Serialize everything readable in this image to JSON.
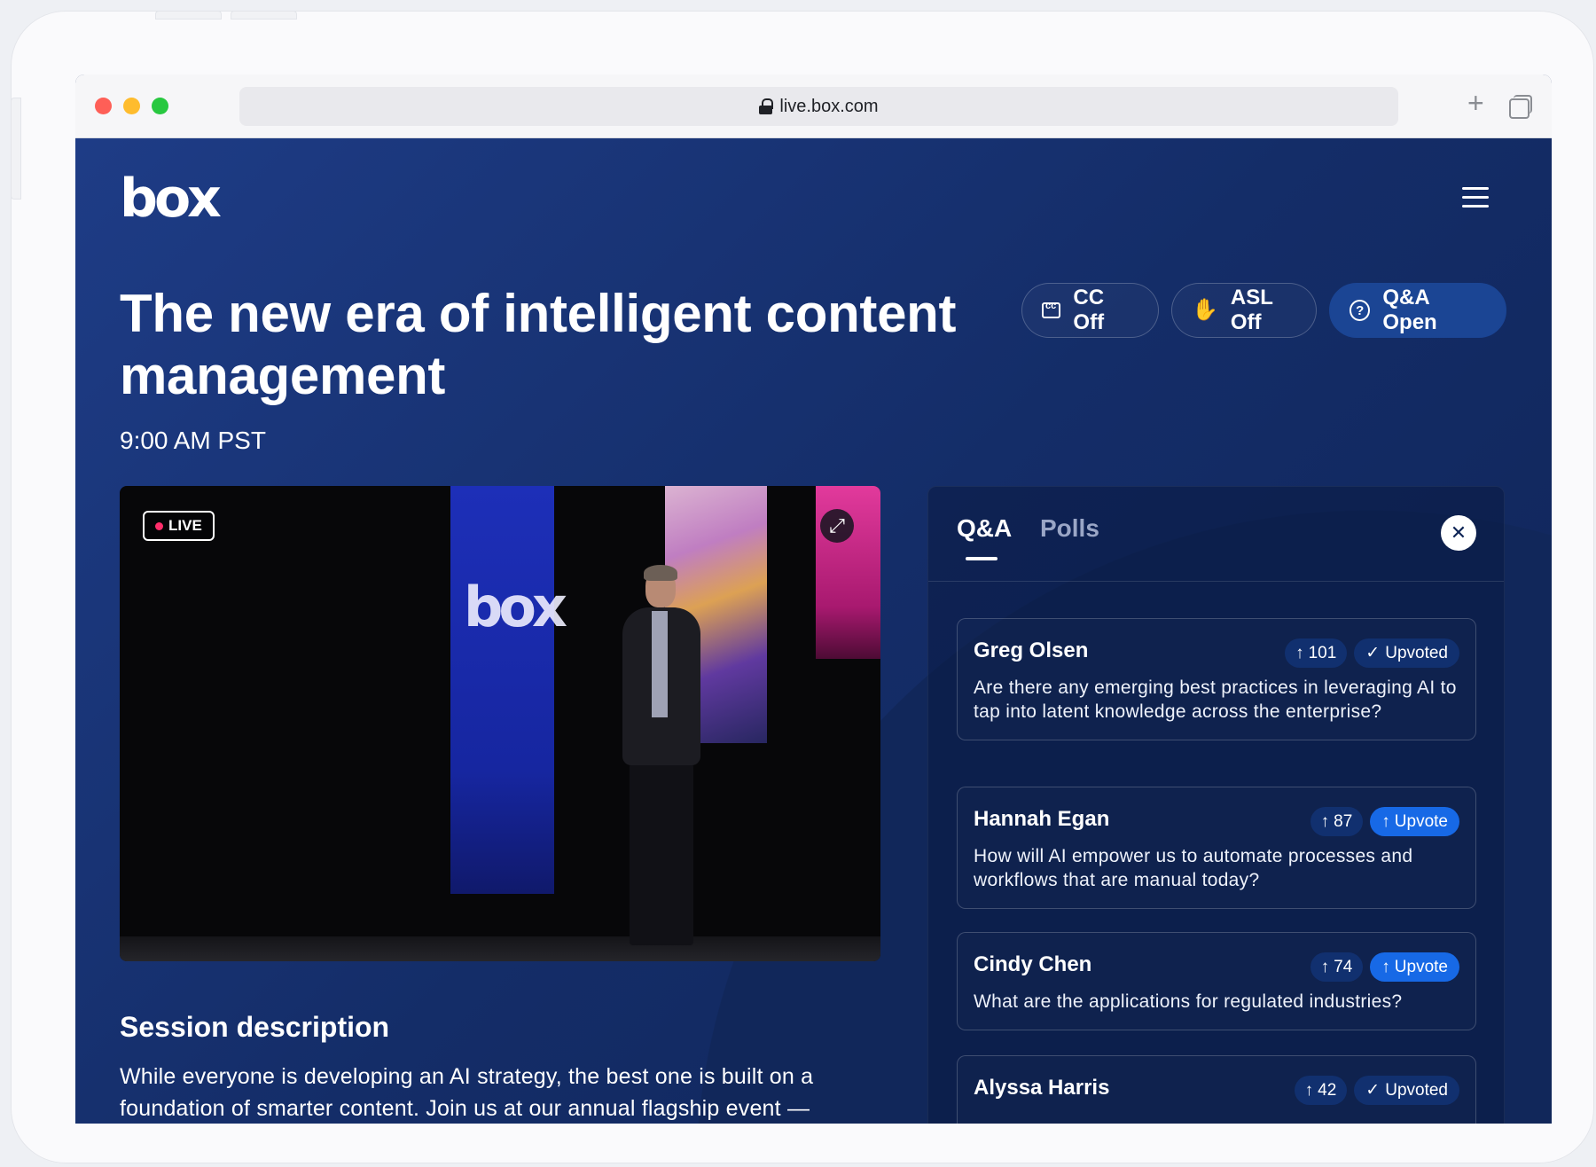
{
  "browser": {
    "url": "live.box.com"
  },
  "header": {
    "logo_text": "box"
  },
  "event": {
    "title": "The new era of intelligent content management",
    "time": "9:00 AM PST"
  },
  "controls": {
    "cc_label": "CC Off",
    "asl_label": "ASL Off",
    "qa_label": "Q&A Open"
  },
  "video": {
    "live_label": "LIVE",
    "screen_logo": "box"
  },
  "session": {
    "heading": "Session description",
    "text": "While everyone is developing an AI strategy, the best one is built on a foundation of smarter content. Join us at our annual flagship event —"
  },
  "panel": {
    "tabs": [
      {
        "label": "Q&A",
        "active": true
      },
      {
        "label": "Polls",
        "active": false
      }
    ],
    "questions": [
      {
        "name": "Greg Olsen",
        "votes": "101",
        "state": "Upvoted",
        "text": "Are there any emerging best practices in leveraging AI to tap into latent knowledge across the enterprise?"
      },
      {
        "name": "Hannah Egan",
        "votes": "87",
        "state": "Upvote",
        "text": "How will AI empower us to automate processes and workflows that are manual today?"
      },
      {
        "name": "Cindy Chen",
        "votes": "74",
        "state": "Upvote",
        "text": "What are the applications for regulated industries?"
      },
      {
        "name": "Alyssa Harris",
        "votes": "42",
        "state": "Upvoted",
        "text": ""
      }
    ]
  },
  "colors": {
    "page_bg": "#172b63",
    "accent_blue": "#1769e6",
    "qa_pill": "#1b4594",
    "live_dot": "#ff2d6a"
  }
}
